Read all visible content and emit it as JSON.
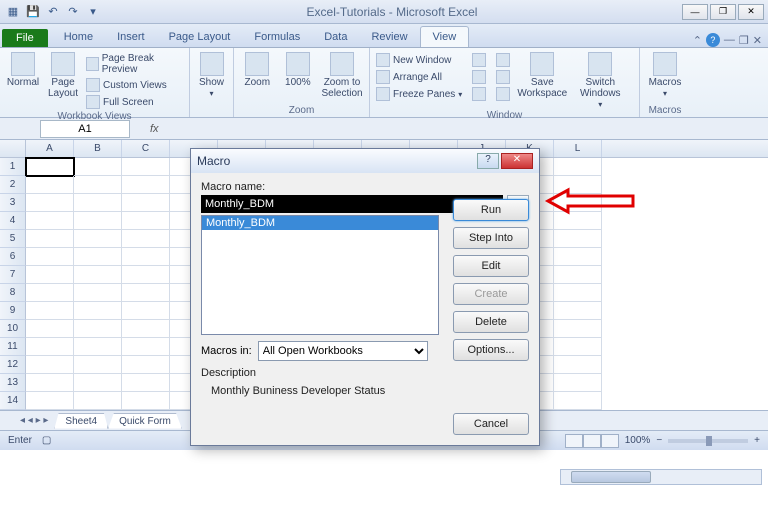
{
  "title": "Excel-Tutorials - Microsoft Excel",
  "tabs": {
    "file": "File",
    "list": [
      "Home",
      "Insert",
      "Page Layout",
      "Formulas",
      "Data",
      "Review",
      "View"
    ],
    "active": "View"
  },
  "ribbon": {
    "workbook_views": {
      "normal": "Normal",
      "page_layout": "Page\nLayout",
      "pbp": "Page Break Preview",
      "custom": "Custom Views",
      "full": "Full Screen",
      "label": "Workbook Views"
    },
    "show": {
      "btn": "Show",
      "label": ""
    },
    "zoom": {
      "zoom": "Zoom",
      "z100": "100%",
      "zsel": "Zoom to\nSelection",
      "label": "Zoom"
    },
    "window": {
      "new": "New Window",
      "arrange": "Arrange All",
      "freeze": "Freeze Panes",
      "save_ws": "Save\nWorkspace",
      "switch": "Switch\nWindows",
      "label": "Window"
    },
    "macros": {
      "btn": "Macros",
      "label": "Macros"
    }
  },
  "namebox": "A1",
  "fx_label": "fx",
  "columns": [
    "A",
    "B",
    "C",
    "",
    "",
    "",
    "",
    "",
    "",
    "J",
    "K",
    "L"
  ],
  "rows": [
    1,
    2,
    3,
    4,
    5,
    6,
    7,
    8,
    9,
    10,
    11,
    12,
    13,
    14
  ],
  "sheets": [
    "Sheet4",
    "Quick Form"
  ],
  "status": {
    "mode": "Enter",
    "zoom": "100%"
  },
  "dialog": {
    "title": "Macro",
    "name_label": "Macro name:",
    "name_value": "Monthly_BDM",
    "list": [
      "Monthly_BDM"
    ],
    "buttons": {
      "run": "Run",
      "step": "Step Into",
      "edit": "Edit",
      "create": "Create",
      "delete": "Delete",
      "options": "Options..."
    },
    "macros_in_label": "Macros in:",
    "macros_in_value": "All Open Workbooks",
    "desc_label": "Description",
    "desc_text": "Monthly Buniness Developer Status",
    "cancel": "Cancel"
  }
}
